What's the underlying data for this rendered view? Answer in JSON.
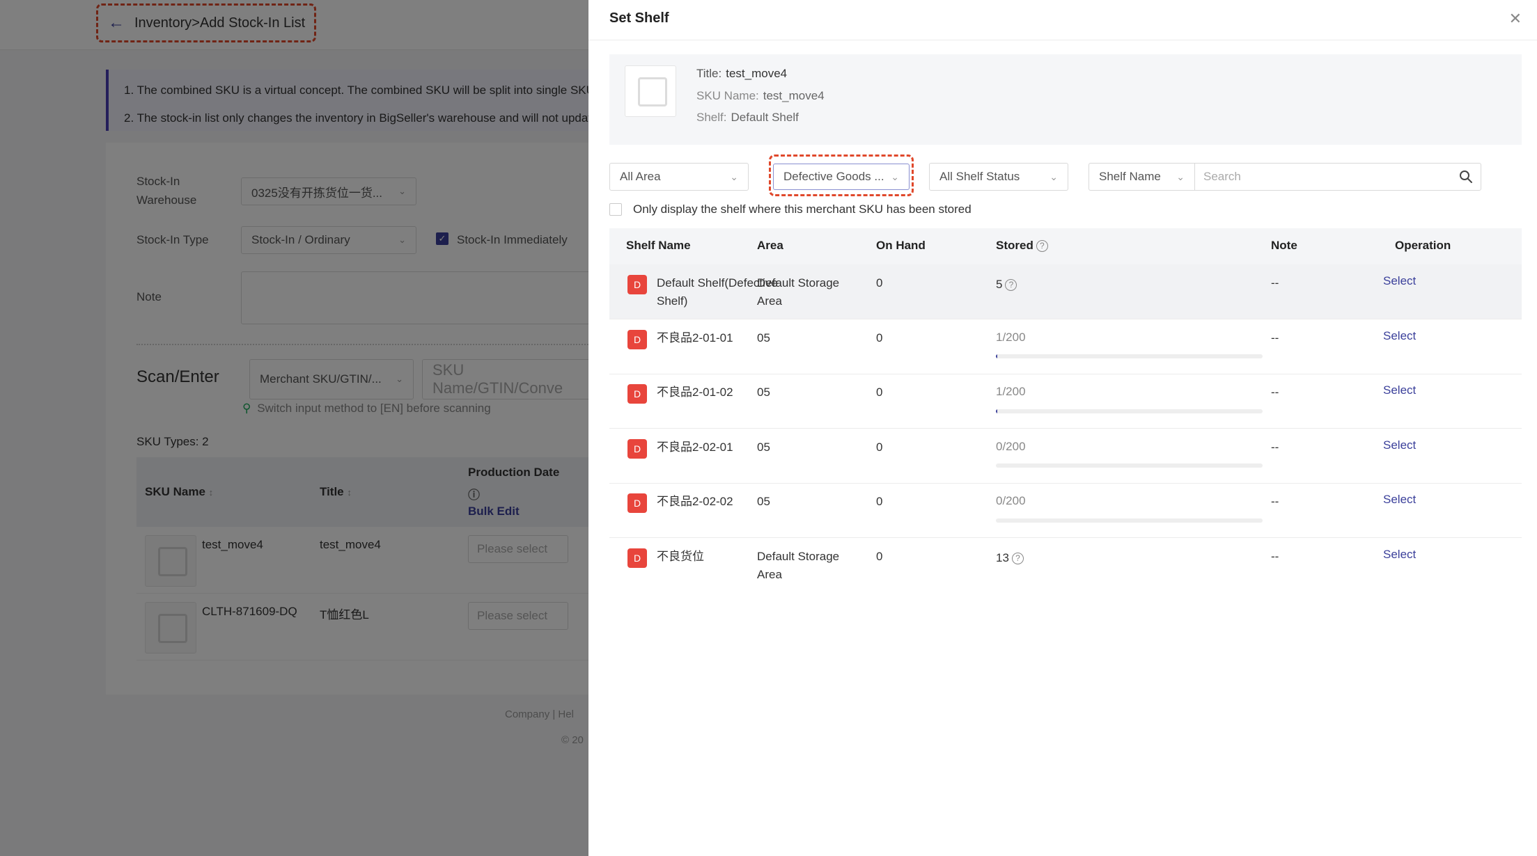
{
  "background": {
    "breadcrumb": "Inventory>Add Stock-In List",
    "notice": [
      "1. The combined SKU is a virtual concept. The combined SKU will be split into single SKUs",
      "2. The stock-in list only changes the inventory in BigSeller's warehouse and will not update"
    ],
    "warehouse_label_1": "Stock-In",
    "warehouse_label_2": "Warehouse",
    "warehouse_value": "0325没有开拣货位一货...",
    "type_label": "Stock-In Type",
    "type_value": "Stock-In / Ordinary",
    "immediately_label": "Stock-In Immediately",
    "note_label": "Note",
    "scan_title": "Scan/Enter",
    "scan_method": "Merchant SKU/GTIN/...",
    "scan_placeholder": "SKU Name/GTIN/Conve",
    "hint": "Switch input method to [EN] before scanning",
    "sku_types": "SKU Types: 2",
    "columns": {
      "sku_name": "SKU Name",
      "title": "Title",
      "production_date": "Production Date",
      "bulk_edit": "Bulk Edit"
    },
    "rows": [
      {
        "sku": "test_move4",
        "title": "test_move4",
        "date_placeholder": "Please select"
      },
      {
        "sku": "CLTH-871609-DQ",
        "title": "T恤红色L",
        "date_placeholder": "Please select"
      }
    ],
    "footer_links": "Company  |  Hel",
    "footer_copy": "© 20"
  },
  "drawer": {
    "title": "Set Shelf",
    "product": {
      "title_label": "Title:",
      "title_value": "test_move4",
      "sku_label": "SKU Name:",
      "sku_value": "test_move4",
      "shelf_label": "Shelf:",
      "shelf_value": "Default Shelf"
    },
    "filters": {
      "area": "All Area",
      "goods_type": "Defective Goods ...",
      "status": "All Shelf Status",
      "search_type": "Shelf Name",
      "search_placeholder": "Search"
    },
    "only_display": "Only display the shelf where this merchant SKU has been stored",
    "columns": {
      "shelf_name": "Shelf Name",
      "area": "Area",
      "on_hand": "On Hand",
      "stored": "Stored",
      "note": "Note",
      "operation": "Operation"
    },
    "rows": [
      {
        "badge": "D",
        "name": "Default Shelf(Defective Shelf)",
        "area": "Default Storage Area",
        "on_hand": "0",
        "stored": "5",
        "note": "--",
        "action": "Select"
      },
      {
        "badge": "D",
        "name": "不良品2-01-01",
        "area": "05",
        "on_hand": "0",
        "stored": "1/200",
        "stored_fraction": 0.005,
        "note": "--",
        "action": "Select"
      },
      {
        "badge": "D",
        "name": "不良品2-01-02",
        "area": "05",
        "on_hand": "0",
        "stored": "1/200",
        "stored_fraction": 0.005,
        "note": "--",
        "action": "Select"
      },
      {
        "badge": "D",
        "name": "不良品2-02-01",
        "area": "05",
        "on_hand": "0",
        "stored": "0/200",
        "stored_fraction": 0,
        "note": "--",
        "action": "Select"
      },
      {
        "badge": "D",
        "name": "不良品2-02-02",
        "area": "05",
        "on_hand": "0",
        "stored": "0/200",
        "stored_fraction": 0,
        "note": "--",
        "action": "Select"
      },
      {
        "badge": "D",
        "name": "不良货位",
        "area": "Default Storage Area",
        "on_hand": "0",
        "stored": "13",
        "note": "--",
        "action": "Select"
      }
    ]
  },
  "colors": {
    "accent": "#3a3f9a",
    "badge": "#e8453c",
    "highlight_dash": "#e0482b"
  }
}
